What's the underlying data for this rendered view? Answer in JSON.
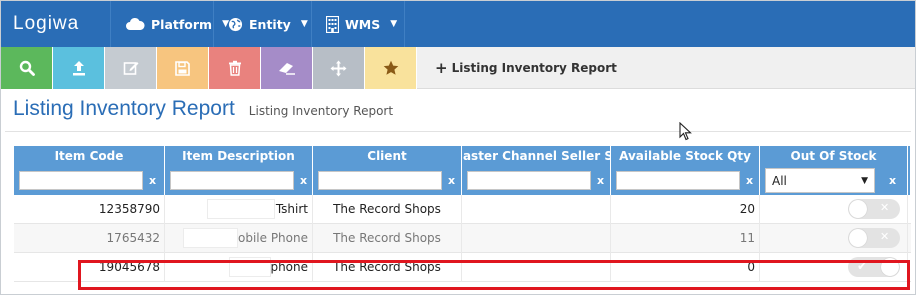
{
  "app": {
    "logo": "Logiwa",
    "menus": [
      {
        "label": "Platform",
        "icon": "cloud-icon"
      },
      {
        "label": "Entity",
        "icon": "globe-icon"
      },
      {
        "label": "WMS",
        "icon": "building-icon"
      }
    ]
  },
  "toolbar": {
    "buttons": [
      {
        "name": "search",
        "icon": "search-icon",
        "color": "#5cb85c"
      },
      {
        "name": "upload",
        "icon": "upload-icon",
        "color": "#5bc0de"
      },
      {
        "name": "edit",
        "icon": "edit-icon",
        "color": "#c5cbd1"
      },
      {
        "name": "save",
        "icon": "save-icon",
        "color": "#f7c57f"
      },
      {
        "name": "delete",
        "icon": "trash-icon",
        "color": "#e9827e"
      },
      {
        "name": "clear",
        "icon": "eraser-icon",
        "color": "#a58cc8"
      },
      {
        "name": "move",
        "icon": "move-icon",
        "color": "#b7bec6"
      },
      {
        "name": "favorite",
        "icon": "star-icon",
        "color": "#f9e29c"
      }
    ],
    "add_report_label": "Listing Inventory Report"
  },
  "page": {
    "title": "Listing Inventory Report",
    "subtitle": "Listing Inventory Report"
  },
  "grid": {
    "columns": [
      "Item Code",
      "Item Description",
      "Client",
      "Master Channel Seller Sk",
      "Available Stock Qty",
      "Out Of Stock"
    ],
    "filter_clear": "x",
    "out_of_stock_filter": "All",
    "rows": [
      {
        "item_code": "12358790",
        "description": "Tshirt",
        "client": "The Record Shops",
        "master_sku": "",
        "qty": "20",
        "out_of_stock": false
      },
      {
        "item_code": "1765432",
        "description": "Mobile Phone",
        "client": "The Record Shops",
        "master_sku": "",
        "qty": "11",
        "out_of_stock": false
      },
      {
        "item_code": "19045678",
        "description": "Iphone",
        "client": "The Record Shops",
        "master_sku": "",
        "qty": "0",
        "out_of_stock": true
      }
    ]
  },
  "colors": {
    "nav_bg": "#2a6db6",
    "grid_header": "#5b9bd5",
    "highlight": "#e0161f"
  }
}
